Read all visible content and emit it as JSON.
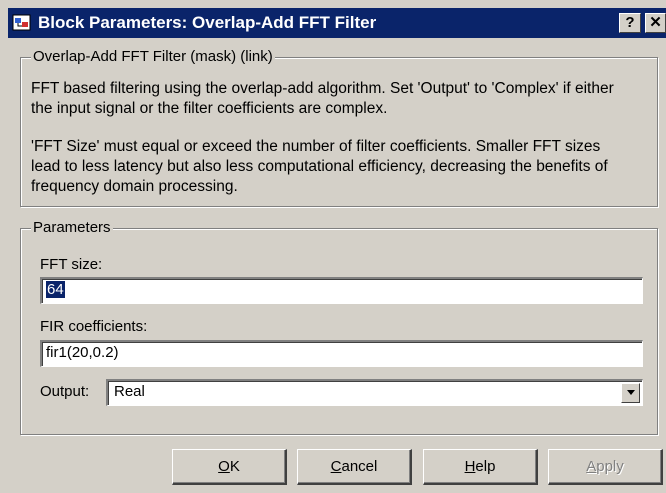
{
  "window": {
    "title": "Block Parameters: Overlap-Add FFT Filter",
    "help_glyph": "?",
    "close_glyph": "✕",
    "accent": "#0a246a"
  },
  "mask_group": {
    "legend": "Overlap-Add FFT Filter (mask) (link)",
    "description_lines": [
      "FFT based filtering using the overlap-add algorithm. Set 'Output' to 'Complex' if either",
      "the input signal or the filter coefficients are complex.",
      "'FFT Size' must equal or exceed the number of filter coefficients.  Smaller FFT sizes",
      "lead to less latency but also less computational efficiency, decreasing the benefits of",
      "frequency domain processing."
    ]
  },
  "params_group": {
    "legend": "Parameters",
    "fft_size_label": "FFT size:",
    "fft_size_value": "64",
    "fir_label": "FIR coefficients:",
    "fir_value": "fir1(20,0.2)",
    "output_label": "Output:",
    "output_value": "Real"
  },
  "buttons": {
    "ok": {
      "accel": "O",
      "rest": "K"
    },
    "cancel": {
      "accel": "C",
      "rest": "ancel"
    },
    "help": {
      "accel": "H",
      "rest": "elp"
    },
    "apply": {
      "accel": "A",
      "rest": "pply"
    }
  },
  "icons": {
    "app": "simulink-block-icon",
    "dropdown": "chevron-down-icon"
  }
}
